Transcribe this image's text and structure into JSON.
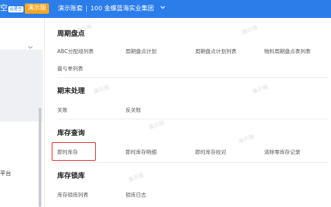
{
  "topbar": {
    "logo_fragment": "空",
    "logo_badge": "云星空",
    "demo_tag": "演示版",
    "account_label": "演示账套",
    "separator": "|",
    "org": "100 金蝶蓝海实业集团"
  },
  "sidebar": {
    "partial_item": "平台"
  },
  "sections": [
    {
      "title": "周期盘点",
      "links": [
        "ABC分配组列表",
        "周期盘点计划",
        "周期盘点计划列表",
        "物料周期盘点表列表",
        "盘亏单列表"
      ]
    },
    {
      "title": "期末处理",
      "links": [
        "关账",
        "反关账"
      ]
    },
    {
      "title": "库存查询",
      "links": [
        "即时库存",
        "即时库存明细",
        "即时库存校对",
        "清除零库存记录"
      ]
    },
    {
      "title": "库存锁库",
      "links": [
        "库存锁库列表",
        "锁库日志"
      ]
    }
  ],
  "watermark": "演示版",
  "colors": {
    "topbar": "#2b7de9",
    "demo_tag": "#f5a623",
    "highlight": "#e02020"
  }
}
